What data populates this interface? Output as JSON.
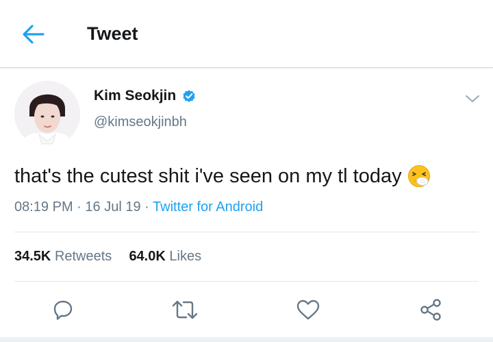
{
  "header": {
    "title": "Tweet",
    "back_icon": "arrow-left-icon",
    "accent": "#1da1f2"
  },
  "tweet": {
    "author_name": "Kim Seokjin",
    "handle": "@kimseokjinbh",
    "verified_icon": "verified-badge-icon",
    "text": "that's the cutest shit i've seen on my tl today",
    "emoji": "sneezing-face-emoji",
    "time": "08:19 PM",
    "date": "16 Jul 19",
    "separator": "·",
    "source": "Twitter for Android"
  },
  "stats": {
    "retweets_count": "34.5K",
    "retweets_label": "Retweets",
    "likes_count": "64.0K",
    "likes_label": "Likes"
  },
  "actions": [
    "reply-icon",
    "retweet-icon",
    "like-icon",
    "share-icon"
  ],
  "colors": {
    "text": "#14171a",
    "secondary": "#657786",
    "link": "#1da1f2",
    "divider": "#e1e8ed"
  }
}
